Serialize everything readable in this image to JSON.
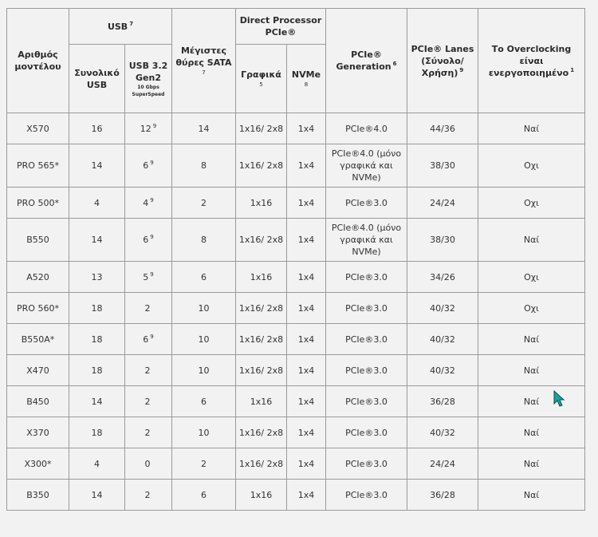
{
  "table": {
    "headers": {
      "model": "Αριθμός μοντέλου",
      "usb_group": "USB",
      "usb_group_sup": "7",
      "usb_total": "Συνολικό USB",
      "usb_gen2": "USB 3.2 Gen2",
      "usb_gen2_small1": "10 Gbps",
      "usb_gen2_small2": "SuperSpeed",
      "sata": "Μέγιστες θύρες SATA",
      "sata_sup": "7",
      "direct_pcie": "Direct Processor PCIe®",
      "graphics": "Γραφικά",
      "graphics_sup": "5",
      "nvme": "NVMe",
      "nvme_sup": "8",
      "pcie_gen": "PCIe® Generation",
      "pcie_gen_sup": "6",
      "lanes": "PCIe® Lanes (Σύνολο/ Χρήση)",
      "lanes_sup": "9",
      "overclock": "Το Overclocking είναι ενεργοποιημένο",
      "overclock_sup": "1"
    },
    "rows": [
      {
        "model": "X570",
        "usb_total": "16",
        "usb_gen2": "12",
        "gen2_sup": "9",
        "sata": "14",
        "graphics": "1x16/ 2x8",
        "nvme": "1x4",
        "pcie_gen": "PCIe®4.0",
        "lanes": "44/36",
        "overclock": "Ναί"
      },
      {
        "model": "PRO 565*",
        "usb_total": "14",
        "usb_gen2": "6",
        "gen2_sup": "9",
        "sata": "8",
        "graphics": "1x16/ 2x8",
        "nvme": "1x4",
        "pcie_gen": "PCIe®4.0 (μόνο γραφικά και NVMe)",
        "lanes": "38/30",
        "overclock": "Οχι"
      },
      {
        "model": "PRO 500*",
        "usb_total": "4",
        "usb_gen2": "4",
        "gen2_sup": "9",
        "sata": "2",
        "graphics": "1x16",
        "nvme": "1x4",
        "pcie_gen": "PCIe®3.0",
        "lanes": "24/24",
        "overclock": "Οχι"
      },
      {
        "model": "B550",
        "usb_total": "14",
        "usb_gen2": "6",
        "gen2_sup": "9",
        "sata": "8",
        "graphics": "1x16/ 2x8",
        "nvme": "1x4",
        "pcie_gen": "PCIe®4.0 (μόνο γραφικά και NVMe)",
        "lanes": "38/30",
        "overclock": "Ναί"
      },
      {
        "model": "A520",
        "usb_total": "13",
        "usb_gen2": "5",
        "gen2_sup": "9",
        "sata": "6",
        "graphics": "1x16",
        "nvme": "1x4",
        "pcie_gen": "PCIe®3.0",
        "lanes": "34/26",
        "overclock": "Οχι"
      },
      {
        "model": "PRO 560*",
        "usb_total": "18",
        "usb_gen2": "2",
        "gen2_sup": "",
        "sata": "10",
        "graphics": "1x16/ 2x8",
        "nvme": "1x4",
        "pcie_gen": "PCIe®3.0",
        "lanes": "40/32",
        "overclock": "Οχι"
      },
      {
        "model": "B550A*",
        "usb_total": "18",
        "usb_gen2": "6",
        "gen2_sup": "9",
        "sata": "10",
        "graphics": "1x16/ 2x8",
        "nvme": "1x4",
        "pcie_gen": "PCIe®3.0",
        "lanes": "40/32",
        "overclock": "Ναί"
      },
      {
        "model": "X470",
        "usb_total": "18",
        "usb_gen2": "2",
        "gen2_sup": "",
        "sata": "10",
        "graphics": "1x16/ 2x8",
        "nvme": "1x4",
        "pcie_gen": "PCIe®3.0",
        "lanes": "40/32",
        "overclock": "Ναί"
      },
      {
        "model": "B450",
        "usb_total": "14",
        "usb_gen2": "2",
        "gen2_sup": "",
        "sata": "6",
        "graphics": "1x16",
        "nvme": "1x4",
        "pcie_gen": "PCIe®3.0",
        "lanes": "36/28",
        "overclock": "Ναί"
      },
      {
        "model": "X370",
        "usb_total": "18",
        "usb_gen2": "2",
        "gen2_sup": "",
        "sata": "10",
        "graphics": "1x16/ 2x8",
        "nvme": "1x4",
        "pcie_gen": "PCIe®3.0",
        "lanes": "40/32",
        "overclock": "Ναί"
      },
      {
        "model": "X300*",
        "usb_total": "4",
        "usb_gen2": "0",
        "gen2_sup": "",
        "sata": "2",
        "graphics": "1x16/ 2x8",
        "nvme": "1x4",
        "pcie_gen": "PCIe®3.0",
        "lanes": "24/24",
        "overclock": "Ναί"
      },
      {
        "model": "B350",
        "usb_total": "14",
        "usb_gen2": "2",
        "gen2_sup": "",
        "sata": "6",
        "graphics": "1x16",
        "nvme": "1x4",
        "pcie_gen": "PCIe®3.0",
        "lanes": "36/28",
        "overclock": "Ναί"
      }
    ]
  },
  "cursor": {
    "icon": "mouse-pointer-icon",
    "color": "#1aa39a"
  }
}
